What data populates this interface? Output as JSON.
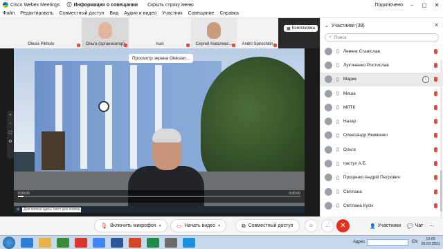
{
  "titlebar": {
    "app_name": "Cisco Webex Meetings",
    "meeting_info": "Информация о совещании",
    "hide_menu": "Скрыть строку меню",
    "connected": "Подключено"
  },
  "menubar": [
    "Файл",
    "Редактировать",
    "Совместный доступ",
    "Вид",
    "Аудио и видео",
    "Участник",
    "Совещание",
    "Справка"
  ],
  "thumbnails": [
    {
      "name": "Olesia Pikholo",
      "subtitle": ""
    },
    {
      "name": "Ольга (организатор)",
      "subtitle": ""
    },
    {
      "name": "Ivan",
      "subtitle": ""
    },
    {
      "name": "Сергей Ковалевс...",
      "subtitle": ""
    },
    {
      "name": "Andrii Spirochkin",
      "subtitle": ""
    }
  ],
  "companion": "Компоновка",
  "share": {
    "view_label": "Просмотр экрана Oleksan...",
    "time_left": "0:00:00",
    "time_right": "0:00:00",
    "progress": 0.02,
    "taskbar_search": "Для поиска здесь текст для поиска"
  },
  "controls": {
    "mic": "Включить микрофон",
    "video": "Начать видео",
    "share": "Совместный доступ",
    "more": "...",
    "participants": "Участники",
    "chat": "Чат"
  },
  "panel": {
    "title": "Участники (38)",
    "search_placeholder": "Поиск",
    "participants": [
      {
        "name": "Левчик Станіслав",
        "selected": false
      },
      {
        "name": "Лук'яненко Ростислав",
        "selected": false
      },
      {
        "name": "Марик",
        "selected": true
      },
      {
        "name": "Миша",
        "selected": false
      },
      {
        "name": "МЛТК",
        "selected": false
      },
      {
        "name": "Назар",
        "selected": false
      },
      {
        "name": "Олександр Якименко",
        "selected": false
      },
      {
        "name": "Ольга",
        "selected": false
      },
      {
        "name": "пастух А.Б.",
        "selected": false
      },
      {
        "name": "Проценко Андрій Петрович",
        "selected": false
      },
      {
        "name": "Світлана",
        "selected": false
      },
      {
        "name": "Світлана Кусік",
        "selected": false
      }
    ]
  },
  "taskbar": {
    "address_label": "Адрес",
    "lang": "EN",
    "time": "13:05",
    "date": "26.03.2021"
  },
  "colors": {
    "end_call": "#e0321f",
    "mic_muted": "#e04a36"
  }
}
